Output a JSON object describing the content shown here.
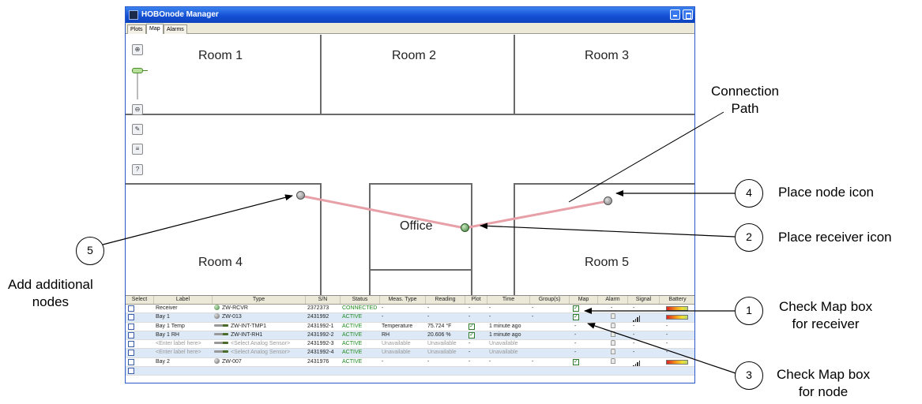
{
  "window": {
    "title": "HOBOnode Manager",
    "tabs": [
      "Plots",
      "Map",
      "Alarms"
    ],
    "active_tab": "Map"
  },
  "map": {
    "rooms": {
      "room1": "Room 1",
      "room2": "Room 2",
      "room3": "Room 3",
      "room4": "Room 4",
      "room5": "Room 5",
      "office": "Office"
    },
    "tools": [
      "zoom-in-icon",
      "zoom-out-icon",
      "edit-icon",
      "layers-icon",
      "help-icon"
    ],
    "path_color": "#e8a0a8"
  },
  "table": {
    "headers": [
      "Select",
      "Label",
      "Type",
      "S/N",
      "Status",
      "Meas. Type",
      "Reading",
      "Plot",
      "Time",
      "Group(s)",
      "Map",
      "Alarm",
      "Signal",
      "Battery"
    ],
    "rows": [
      {
        "label": "Receiver",
        "type": "ZW-RCVR",
        "type_icon": "receiver",
        "sn": "2372373",
        "status": "CONNECTED",
        "meas": "-",
        "reading": "-",
        "plot": "-",
        "time": "-",
        "group": "-",
        "map": true,
        "alarm": "-",
        "signal": "-",
        "battery": true
      },
      {
        "label": "Bay 1",
        "type": "ZW-013",
        "type_icon": "node",
        "sn": "2431992",
        "status": "ACTIVE",
        "meas": "-",
        "reading": "-",
        "plot": "-",
        "time": "-",
        "group": "-",
        "map": true,
        "alarm": "bell",
        "signal": "bars",
        "battery": true
      },
      {
        "label": "Bay 1 Temp",
        "type": "ZW-INT-TMP1",
        "type_icon": "probe",
        "sn": "2431992-1",
        "status": "ACTIVE",
        "meas": "Temperature",
        "reading": "75.724 °F",
        "plot": "check",
        "time": "1 minute ago",
        "group": "",
        "map": false,
        "alarm": "bell",
        "signal": "-",
        "battery": false
      },
      {
        "label": "Bay 1 RH",
        "type": "ZW-INT-RH1",
        "type_icon": "probe",
        "sn": "2431992-2",
        "status": "ACTIVE",
        "meas": "RH",
        "reading": "20.606 %",
        "plot": "check",
        "time": "1 minute ago",
        "group": "",
        "map": false,
        "alarm": "bell",
        "signal": "-",
        "battery": false
      },
      {
        "label": "<Enter label here>",
        "type": "<Select Analog Sensor>",
        "type_icon": "probe",
        "sn": "2431992-3",
        "status": "ACTIVE",
        "meas": "Unavailable",
        "reading": "Unavailable",
        "plot": "-",
        "time": "Unavailable",
        "group": "",
        "map": false,
        "alarm": "bell",
        "signal": "-",
        "battery": false
      },
      {
        "label": "<Enter label here>",
        "type": "<Select Analog Sensor>",
        "type_icon": "probe",
        "sn": "2431992-4",
        "status": "ACTIVE",
        "meas": "Unavailable",
        "reading": "Unavailable",
        "plot": "-",
        "time": "Unavailable",
        "group": "",
        "map": false,
        "alarm": "bell",
        "signal": "-",
        "battery": false
      },
      {
        "label": "Bay 2",
        "type": "ZW-007",
        "type_icon": "node",
        "sn": "2431976",
        "status": "ACTIVE",
        "meas": "-",
        "reading": "-",
        "plot": "-",
        "time": "-",
        "group": "-",
        "map": true,
        "alarm": "bell",
        "signal": "bars",
        "battery": true
      },
      {
        "label": "",
        "type": "",
        "type_icon": "none",
        "sn": "",
        "status": "",
        "meas": "",
        "reading": "",
        "plot": "",
        "time": "",
        "group": "",
        "map": false,
        "alarm": "",
        "signal": "",
        "battery": false
      }
    ]
  },
  "callouts": {
    "connection_path": [
      "Connection",
      "Path"
    ],
    "c1": {
      "num": "1",
      "lines": [
        "Check Map box",
        "for receiver"
      ]
    },
    "c2": {
      "num": "2",
      "lines": [
        "Place receiver icon"
      ]
    },
    "c3": {
      "num": "3",
      "lines": [
        "Check Map box",
        "for node"
      ]
    },
    "c4": {
      "num": "4",
      "lines": [
        "Place node icon"
      ]
    },
    "c5": {
      "num": "5",
      "lines": [
        "Add additional",
        "nodes"
      ]
    }
  }
}
